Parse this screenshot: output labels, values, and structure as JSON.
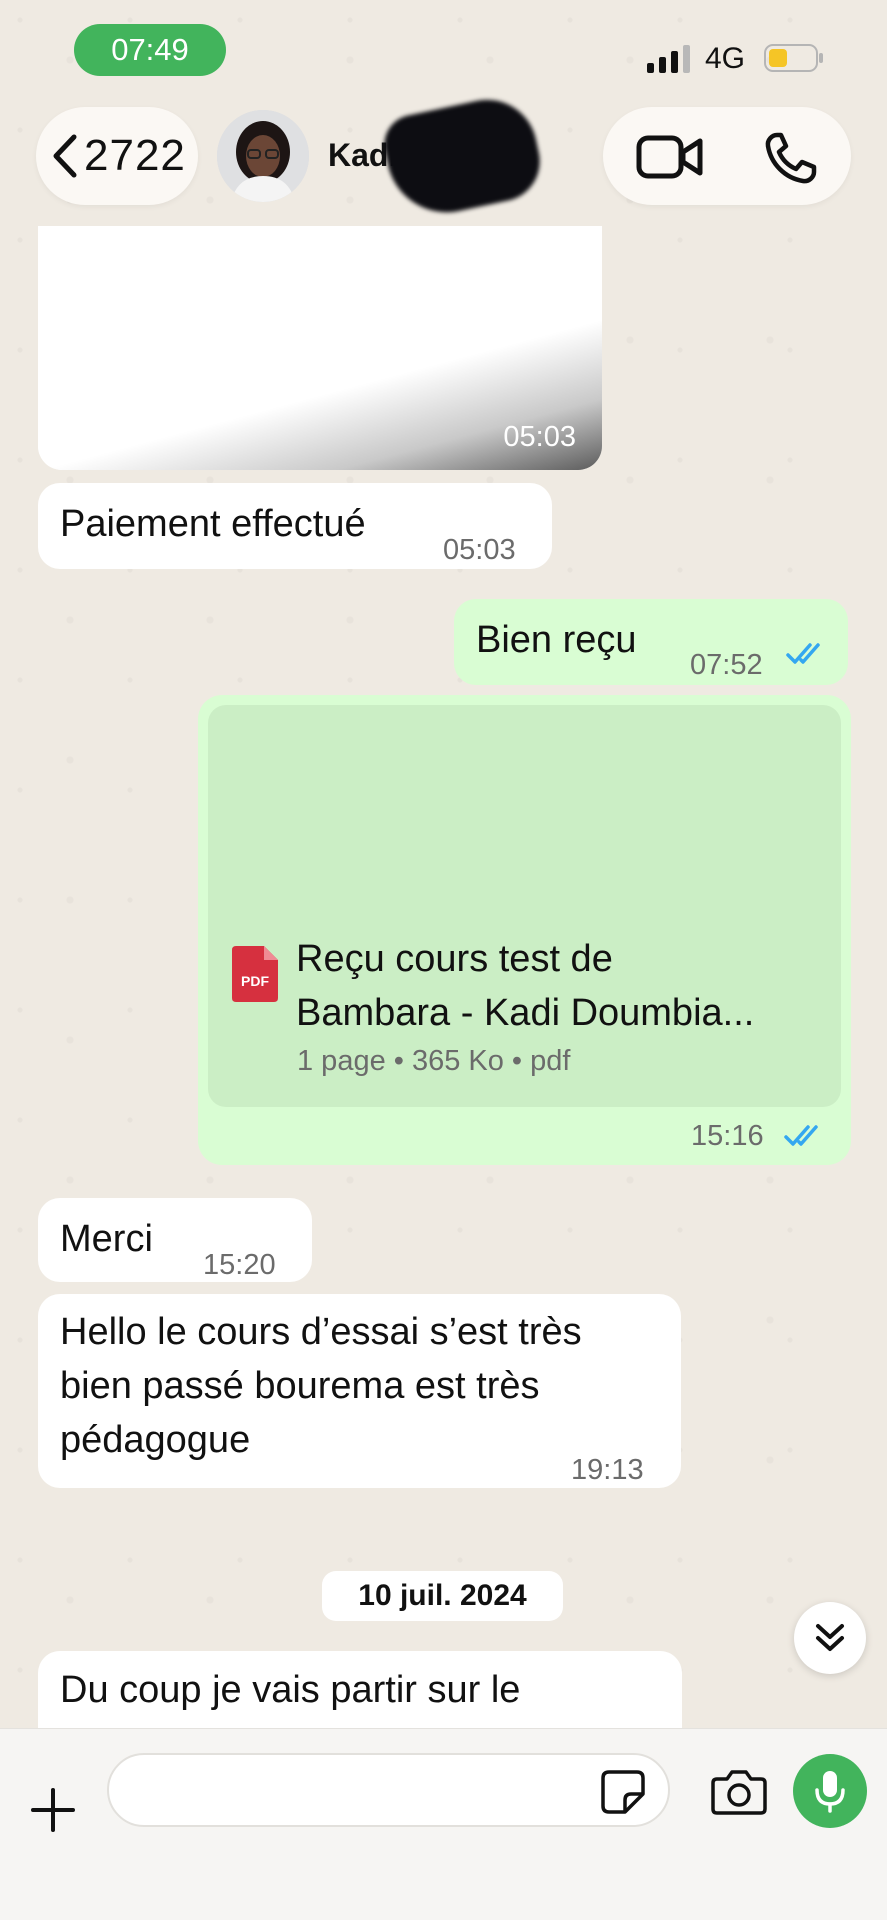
{
  "status_bar": {
    "time": "07:49",
    "network": "4G",
    "icons": [
      "signal-icon",
      "battery-icon"
    ],
    "colors": {
      "time_pill": "#42b45c",
      "battery_level": "#f5c526"
    }
  },
  "header": {
    "back_count": "2722",
    "contact_name": "Kadi D",
    "icons": [
      "back-chevron-icon",
      "video-call-icon",
      "phone-call-icon"
    ]
  },
  "messages": [
    {
      "type": "media",
      "direction": "incoming",
      "time": "05:03"
    },
    {
      "type": "text",
      "direction": "incoming",
      "text": "Paiement effectué",
      "time": "05:03"
    },
    {
      "type": "text",
      "direction": "outgoing",
      "text": "Bien reçu",
      "time": "07:52",
      "read": true
    },
    {
      "type": "document",
      "direction": "outgoing",
      "title_line1": "Reçu cours test de",
      "title_line2": "Bambara - Kadi Doumbia...",
      "meta": "1 page • 365 Ko • pdf",
      "icon_label": "PDF",
      "time": "15:16",
      "read": true
    },
    {
      "type": "text",
      "direction": "incoming",
      "text": "Merci",
      "time": "15:20"
    },
    {
      "type": "text",
      "direction": "incoming",
      "lines": [
        "Hello le cours d’essai s’est très",
        "bien passé bourema est très",
        "pédagogue"
      ],
      "time": "19:13"
    },
    {
      "type": "text",
      "direction": "incoming",
      "lines": [
        "Du coup je vais partir sur le"
      ]
    }
  ],
  "date_separator": "10 juil. 2024",
  "composer": {
    "placeholder": "",
    "icons": [
      "plus-icon",
      "sticker-icon",
      "camera-icon",
      "microphone-icon",
      "scroll-down-icon"
    ],
    "colors": {
      "mic_button": "#42b45c",
      "outgoing_bubble": "#d9fdd3",
      "read_ticks": "#34a7f0"
    }
  }
}
